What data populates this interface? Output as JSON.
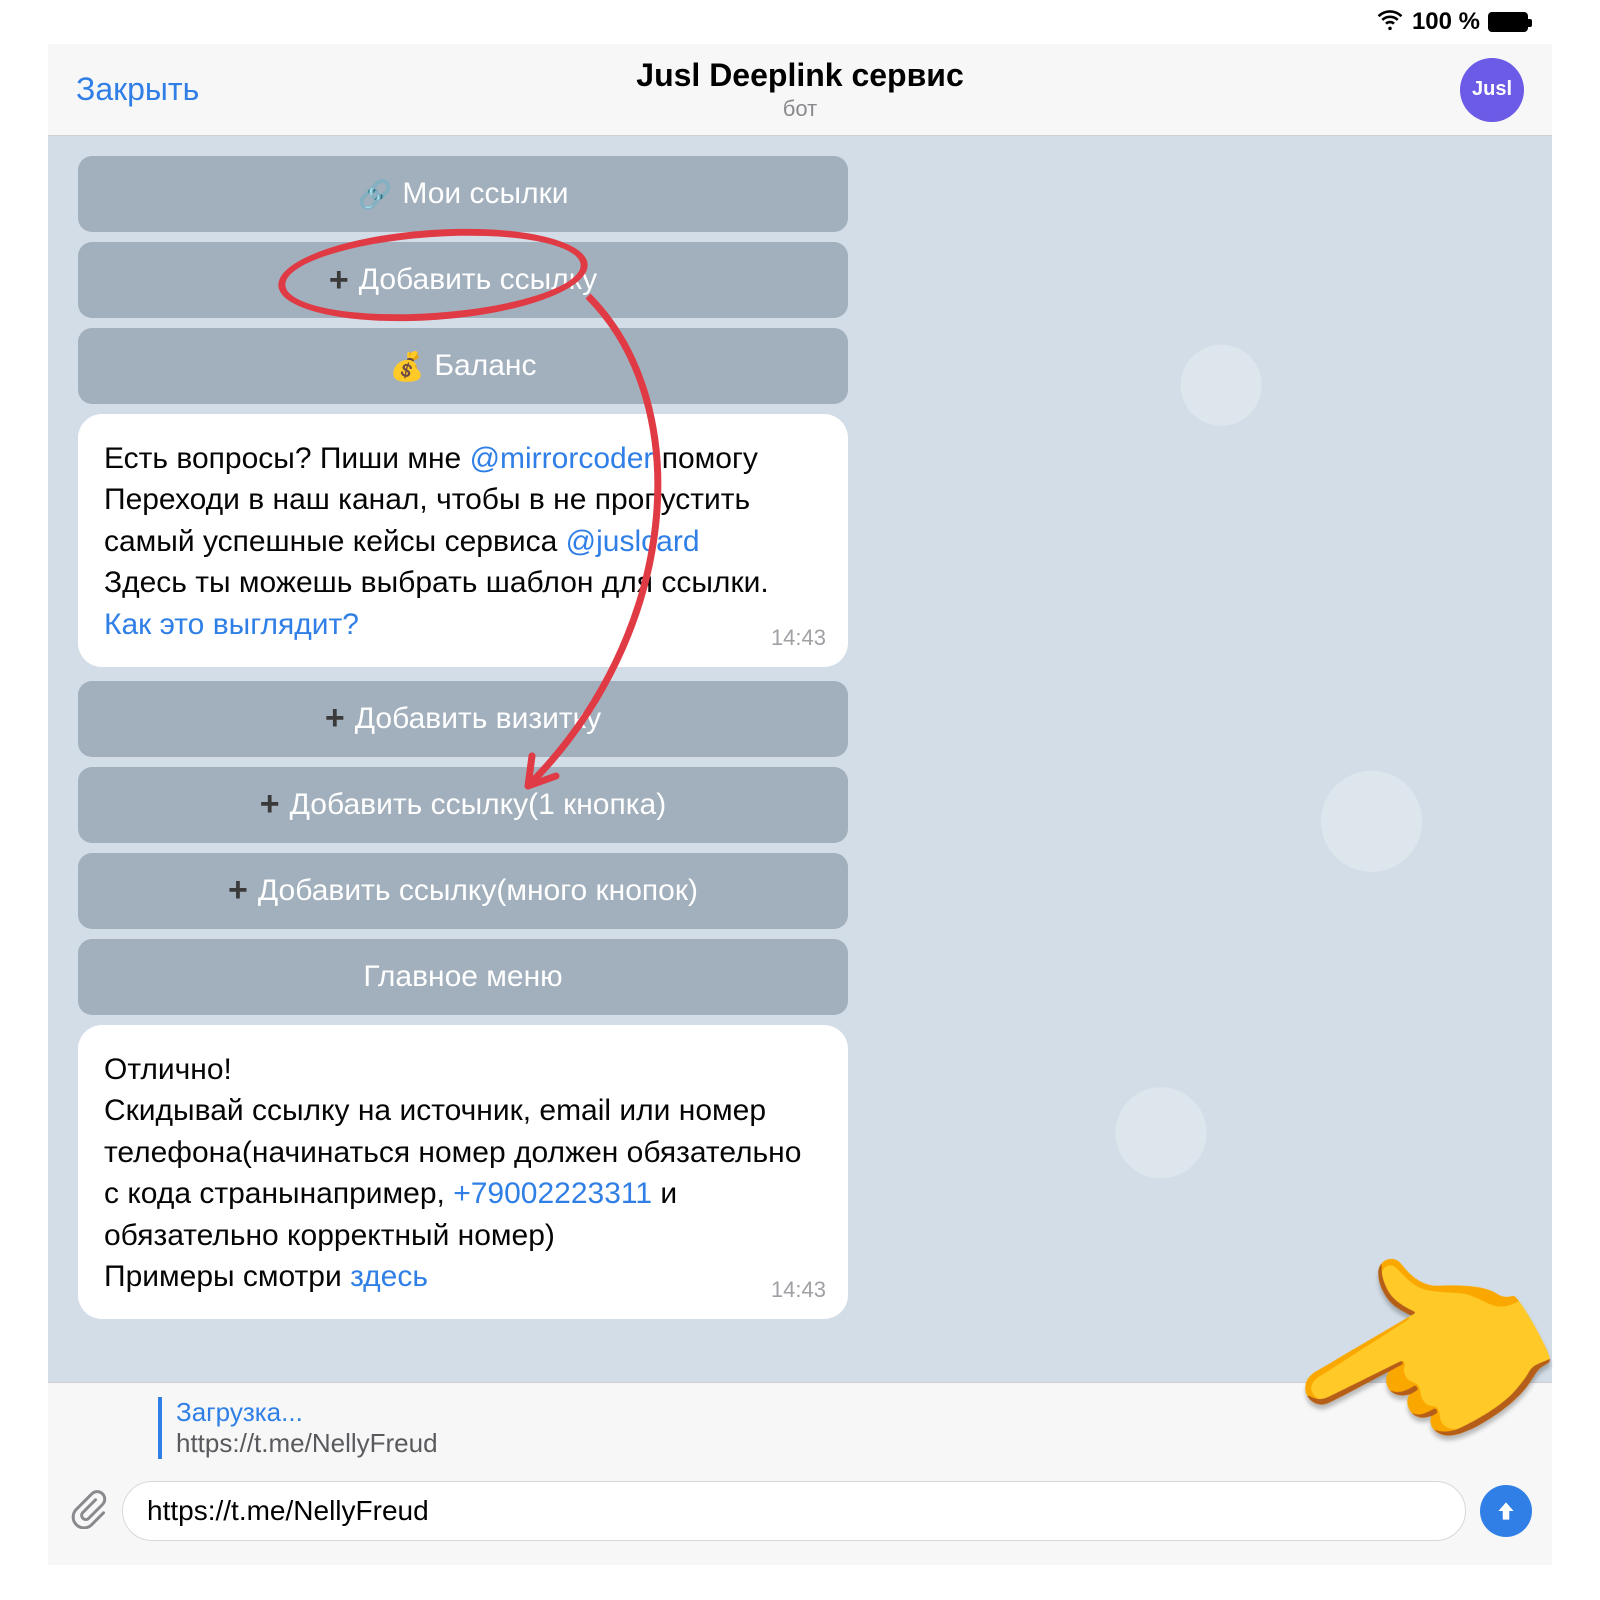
{
  "status": {
    "battery": "100 %"
  },
  "header": {
    "close": "Закрыть",
    "title": "Jusl Deeplink сервис",
    "subtitle": "бот",
    "avatar_label": "Jusl"
  },
  "kb_top": {
    "my_links": "Мои ссылки",
    "add_link": "Добавить ссылку",
    "balance": "Баланс"
  },
  "msg1": {
    "line1a": "Есть вопросы? Пиши мне ",
    "mention1": "@mirrorcoder",
    "line1b": " помогу",
    "line2": "Переходи в наш канал, чтобы в не пропустить самый успешные кейсы сервиса ",
    "mention2": "@juslcard",
    "line3": "Здесь ты можешь выбрать шаблон для ссылки.",
    "link": "Как это выглядит?",
    "time": "14:43"
  },
  "kb_mid": {
    "add_card": "Добавить визитку",
    "add_link1": "Добавить ссылку(1 кнопка)",
    "add_linkN": "Добавить ссылку(много кнопок)",
    "main_menu": "Главное меню"
  },
  "msg2": {
    "line1": "Отлично!",
    "line2": "Скидывай ссылку на источник, email или номер телефона(начинаться номер должен обязательно с кода странынапример, ",
    "phone": "+79002223311",
    "line2b": " и обязательно корректный номер)",
    "line3a": "Примеры смотри ",
    "here": "здесь",
    "time": "14:43"
  },
  "reply": {
    "title": "Загрузка...",
    "text": "https://t.me/NellyFreud"
  },
  "input": {
    "value": "https://t.me/NellyFreud"
  }
}
